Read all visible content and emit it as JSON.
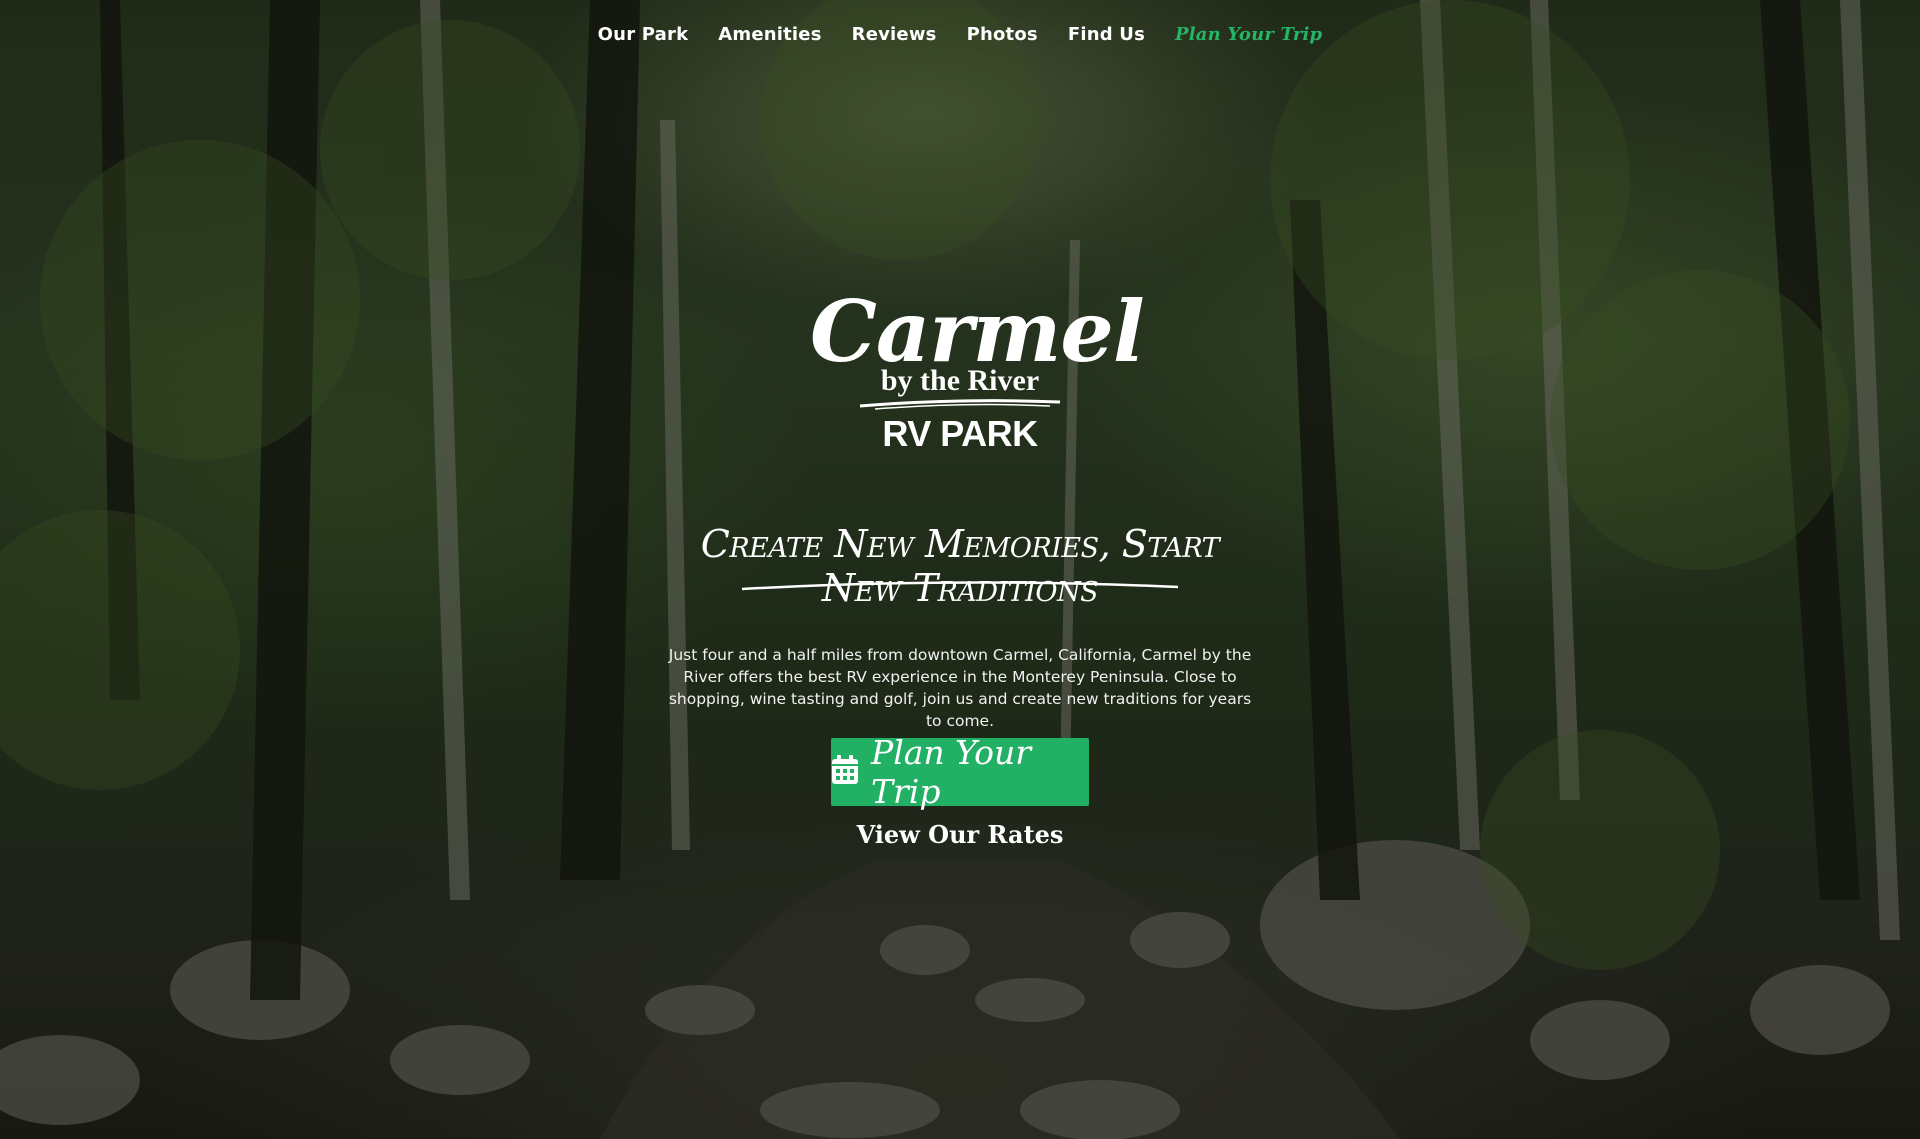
{
  "nav": {
    "items": [
      "Our Park",
      "Amenities",
      "Reviews",
      "Photos",
      "Find Us"
    ],
    "cta_label": "Plan Your Trip",
    "cta_color": "#26b466"
  },
  "logo": {
    "line1": "Carmel",
    "line2": "by the River",
    "line3": "RV PARK"
  },
  "hero": {
    "tagline": "Create New Memories, Start New Traditions",
    "description": "Just four and a half miles from downtown Carmel, California, Carmel by the River offers the best RV experience in the Monterey Peninsula. Close to shopping, wine tasting and golf, join us and create new traditions for years to come.",
    "button_label": "Plan Your Trip",
    "button_icon": "calendar-icon",
    "button_color": "#22b064",
    "rates_label": "View Our Rates"
  }
}
